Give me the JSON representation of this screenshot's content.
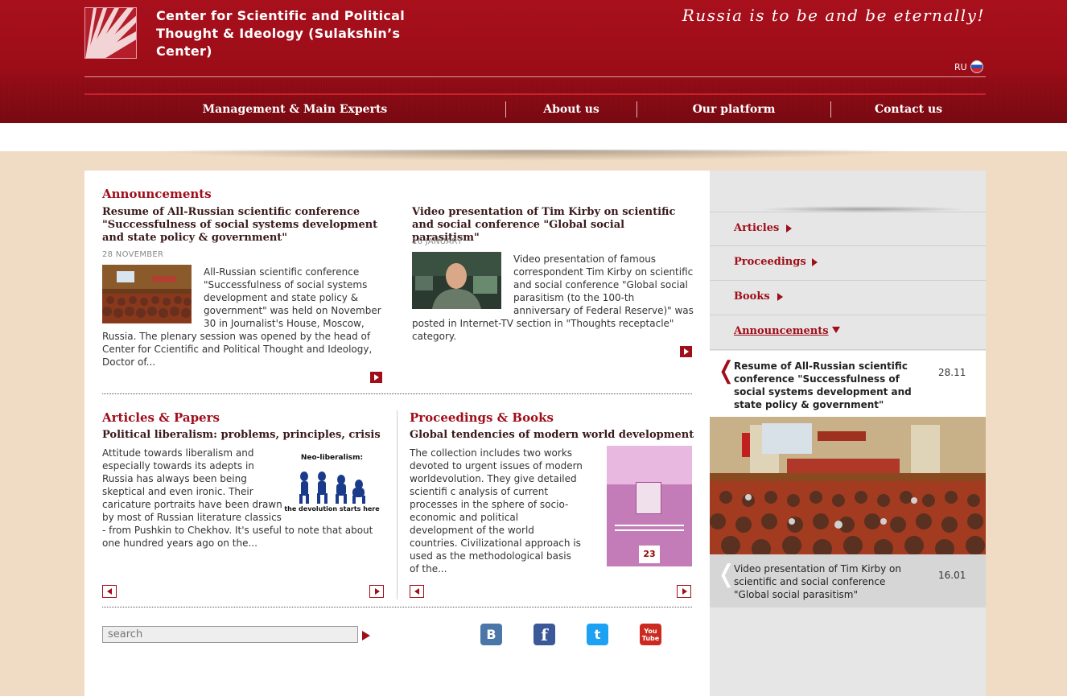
{
  "header": {
    "title": "Center for Scientific and Political Thought & Ideology (Sulakshin’s Center)",
    "slogan": "Russia is to be and be eternally!",
    "lang": "RU"
  },
  "nav": [
    {
      "label": "Management & Main Experts"
    },
    {
      "label": "About us"
    },
    {
      "label": "Our platform"
    },
    {
      "label": "Contact us"
    }
  ],
  "announcements": {
    "heading": "Announcements",
    "items": [
      {
        "title": "Resume of All-Russian scientific conference \"Successfulness of social systems development and state policy & government\"",
        "date": "28 NOVEMBER",
        "text": "All-Russian scientific conference \"Successfulness of social systems development and state policy & government\" was held on November 30 in Journalist's House, Moscow, Russia. The plenary session was opened by the head of Center for Ccientific and Political Thought and Ideology, Doctor of..."
      },
      {
        "title": "Video presentation of Tim Kirby on scientific and social conference \"Global social parasitism\"",
        "date": "16 JANUARY",
        "text": "Video presentation of famous correspondent Tim Kirby on scientific and social conference \"Global social parasitism (to the 100-th anniversary of Federal Reserve)\" was posted in Internet-TV section in \"Thoughts receptacle\" category."
      }
    ]
  },
  "articles": {
    "heading": "Articles & Papers",
    "title": "Political liberalism: problems, principles, crisis",
    "text": "Attitude towards liberalism and especially towards its adepts in Russia has always been being skeptical and even ironic. Their caricature portraits have been drawn by most of Russian literature classics - from Pushkin to Chekhov. It's useful to note that about one hundred years ago on the...",
    "image_caption_top": "Neo-liberalism:",
    "image_caption_bottom": "the devolution starts here"
  },
  "proceedings": {
    "heading": "Proceedings & Books",
    "title": "Global tendencies of modern world development",
    "text": "The collection includes two works devoted to urgent issues of modern worldevolution. They give detailed scientifi c analysis of current processes in the sphere of socio-economic and political development of the world countries. Civilizational approach is used as the methodological basis of the...",
    "book_number": "23"
  },
  "search": {
    "placeholder": "search"
  },
  "social": [
    {
      "name": "vk-icon",
      "glyph": "B",
      "color": "#4a76a8"
    },
    {
      "name": "facebook-icon",
      "glyph": "f",
      "color": "#3b5998"
    },
    {
      "name": "twitter-icon",
      "glyph": "t",
      "color": "#1da1f2"
    },
    {
      "name": "youtube-icon",
      "glyph": "You Tube",
      "color": "#cc2a20"
    }
  ],
  "sidebar": {
    "menu": [
      {
        "label": "Articles"
      },
      {
        "label": "Proceedings"
      },
      {
        "label": "Books"
      },
      {
        "label": "Announcements"
      }
    ],
    "cards": [
      {
        "title": "Resume of All-Russian scientific conference \"Successfulness of social systems development and state policy & government\"",
        "date": "28.11"
      },
      {
        "title": "Video presentation of Tim Kirby on scientific and social conference \"Global social parasitism\"",
        "date": "16.01"
      }
    ]
  },
  "colors": {
    "brand": "#a00e1a",
    "background": "#f0dcc4"
  }
}
